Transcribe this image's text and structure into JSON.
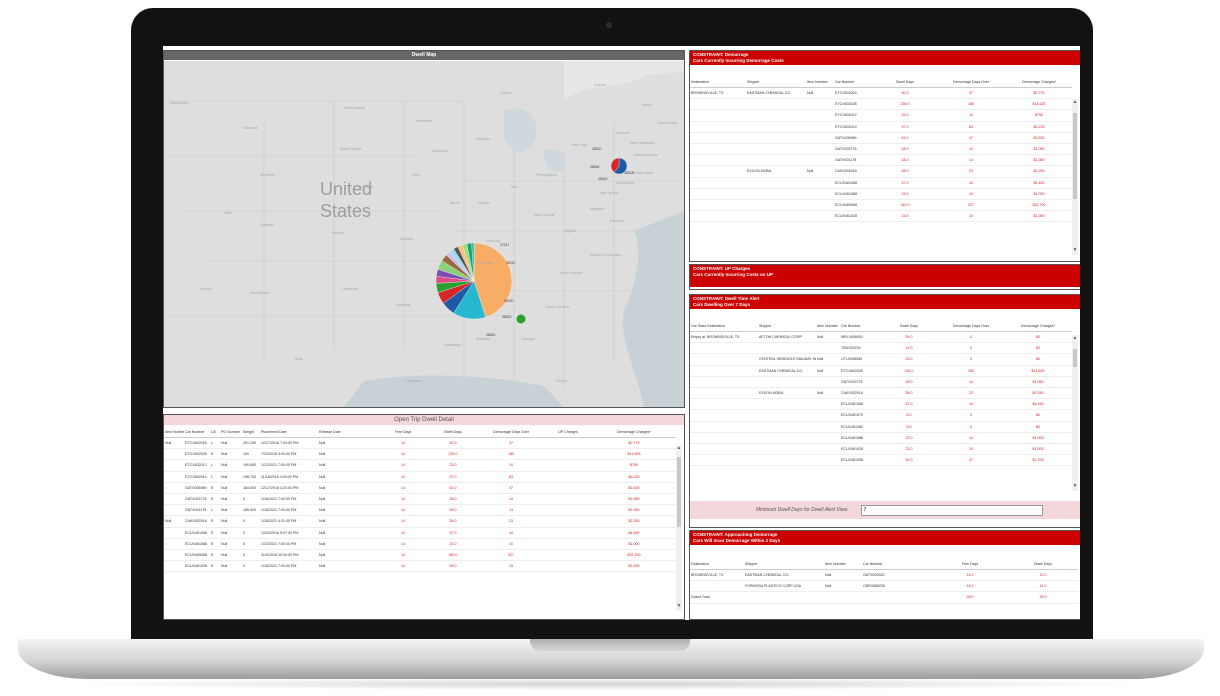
{
  "map": {
    "title": "Dwell Map",
    "big_labels": [
      "United",
      "States"
    ],
    "region_labels": [
      "Montana",
      "North Dakota",
      "Minnesota",
      "South Dakota",
      "Wyoming",
      "Nebraska",
      "Iowa",
      "Illinois",
      "Indiana",
      "Ohio",
      "Michigan",
      "Wisconsin",
      "Pennsylvania",
      "New York",
      "Vermont",
      "Maine",
      "Kansas",
      "Missouri",
      "Kentucky",
      "Virginia",
      "West Virginia",
      "Oklahoma",
      "Arkansas",
      "Tennessee",
      "North Carolina",
      "South Carolina",
      "Georgia",
      "Alabama",
      "Mississippi",
      "Louisiana",
      "Texas",
      "New Jersey",
      "Maryland",
      "Delaware",
      "Rhode Island",
      "Massachusetts",
      "Colorado",
      "New Mexico",
      "Florida",
      "Quebec",
      "Ontario",
      "District of Columbia",
      "Washington",
      "Utah",
      "Arizona",
      "Nova Scotia",
      "Connecticut",
      "New Hampshire"
    ],
    "pie_labels": [
      "38520",
      "38564",
      "38518",
      "37211",
      "35010",
      "35250",
      "38520",
      "38620",
      "39520"
    ],
    "pie_colors": [
      "#f8ad66",
      "#27b8cf",
      "#1f5aa8",
      "#d62728",
      "#2ca02c",
      "#e04c8a",
      "#7b4fb2",
      "#8bd17c",
      "#9a6b3e",
      "#c9c2e8",
      "#9edae5",
      "#555555",
      "#ffbb78",
      "#98df8a",
      "#2a9d5f",
      "#17becf"
    ]
  },
  "open_trip": {
    "title": "Open Trip Dwell Detail",
    "columns": [
      "Item Number",
      "Car Number",
      "L/E",
      "PO Number",
      "Weight",
      "Placement Date",
      "Release Date",
      "Free Days",
      "Dwell Days",
      "Demurrage Days Over",
      "UP Charges",
      "Demurrage Charges*"
    ],
    "rows": [
      [
        "Null",
        "ETCX602016",
        "L",
        "Null",
        "201,150",
        "12/27/2016 7:04:00 PM",
        "Null",
        "14",
        "52.0",
        "37",
        "",
        "$2,775"
      ],
      [
        "",
        "ETCX602028",
        "E",
        "Null",
        "100",
        "7/22/2016 3:00:00 PM",
        "Null",
        "14",
        "230.0",
        "180",
        "",
        "$14,625"
      ],
      [
        "",
        "ETCX602012",
        "L",
        "Null",
        "190,850",
        "1/22/2021 7:00:00 PM",
        "Null",
        "14",
        "23.0",
        "10",
        "",
        "$750"
      ],
      [
        "",
        "ETCX602014",
        "L",
        "Null",
        "198,700",
        "11/18/2016 4:00:00 PM",
        "Null",
        "14",
        "97.0",
        "83",
        "",
        "$6,225"
      ],
      [
        "",
        "GATX006989",
        "E",
        "Null",
        "184,000",
        "12/17/2016 3:20:00 PM",
        "Null",
        "14",
        "61.0",
        "47",
        "",
        "$3,525"
      ],
      [
        "",
        "GATX003778",
        "E",
        "Null",
        "0",
        "1/16/2021 7:00:00 PM",
        "Null",
        "14",
        "28.0",
        "14",
        "",
        "$1,050"
      ],
      [
        "",
        "GATX001178",
        "L",
        "Null",
        "185,900",
        "1/16/2021 7:00:00 PM",
        "Null",
        "14",
        "28.0",
        "14",
        "",
        "$1,050"
      ],
      [
        "Null",
        "CAKX002016",
        "E",
        "Null",
        "0",
        "1/15/2021 4:31:00 PM",
        "Null",
        "14",
        "38.0",
        "23",
        "",
        "$2,250"
      ],
      [
        "",
        "ECUX461068",
        "E",
        "Null",
        "0",
        "12/20/2016 5:47:00 PM",
        "Null",
        "14",
        "57.0",
        "44",
        "",
        "$4,450"
      ],
      [
        "",
        "ECUX461088",
        "E",
        "Null",
        "0",
        "1/22/2021 7:00:00 PM",
        "Null",
        "14",
        "23.0",
        "10",
        "",
        "$1,000"
      ],
      [
        "",
        "ECUX469068",
        "E",
        "Null",
        "0",
        "3/10/2016 10:00:00 PM",
        "Null",
        "14",
        "340.0",
        "327",
        "",
        "$32,700"
      ],
      [
        "",
        "ECUX461028",
        "E",
        "Null",
        "0",
        "1/16/2021 7:00:00 PM",
        "Null",
        "14",
        "28.0",
        "15",
        "",
        "$1,500"
      ]
    ]
  },
  "demurrage": {
    "title": "CONSTRAINT:  Demurrage",
    "subtitle": "Cars Currently Incurring Demurrage Costs",
    "columns": [
      "Destination",
      "Shipper",
      "Item Number",
      "Car Number",
      "Dwell Days",
      "Demurrage Days Over",
      "Demurrage Charges*"
    ],
    "rows": [
      [
        "BROWNSVILLE, TX",
        "EASTMAN CHEMICAL CO.",
        "Null",
        "ETCX602016",
        "50.0",
        "37",
        "$2,775"
      ],
      [
        "",
        "",
        "",
        "ETCX602028",
        "230.0",
        "180",
        "$14,625"
      ],
      [
        "",
        "",
        "",
        "ETCX602012",
        "23.0",
        "10",
        "$750"
      ],
      [
        "",
        "",
        "",
        "ETCX602014",
        "97.0",
        "83",
        "$6,225"
      ],
      [
        "",
        "",
        "",
        "GATX006989",
        "61.0",
        "47",
        "$3,525"
      ],
      [
        "",
        "",
        "",
        "GATX003778",
        "28.0",
        "14",
        "$1,050"
      ],
      [
        "",
        "",
        "",
        "GATX001178",
        "28.0",
        "14",
        "$1,050"
      ],
      [
        "",
        "EXXON MOBIL",
        "Null",
        "CAKX002016",
        "38.0",
        "23",
        "$2,250"
      ],
      [
        "",
        "",
        "",
        "ECUX461068",
        "57.0",
        "44",
        "$4,450"
      ],
      [
        "",
        "",
        "",
        "ECUX461088",
        "23.0",
        "10",
        "$1,000"
      ],
      [
        "",
        "",
        "",
        "ECUX469068",
        "340.0",
        "327",
        "$32,700"
      ],
      [
        "",
        "",
        "",
        "ECUX461028",
        "23.0",
        "10",
        "$1,000"
      ]
    ]
  },
  "up_charges": {
    "title": "CONSTRAINT:  UP Charges",
    "subtitle": "Cars Currently Incurring Costs on UP"
  },
  "dwell_alert": {
    "title": "CONSTRAINT:  Dwell Time Alert",
    "subtitle": "Cars Dwelling Over 7 Days",
    "columns": [
      "Car Status",
      "Destination",
      "Shipper",
      "Item Number",
      "Car Number",
      "Dwell Days",
      "Demurrage Days Over",
      "Demurrage Charges*"
    ],
    "rows": [
      [
        "Empty at Dest",
        "BROWNSVILLE, TX",
        "AFTON CHEMICAL CORP",
        "Null",
        "MRLX006051",
        "55.0",
        "0",
        "$0"
      ],
      [
        "",
        "",
        "",
        "",
        "TBDX00234",
        "19.0",
        "0",
        "$0"
      ],
      [
        "",
        "",
        "CENTRAL SEMINOLE RAILWAY INC",
        "Null",
        "UTLX008089",
        "20.0",
        "0",
        "$0"
      ],
      [
        "",
        "",
        "EASTMAN CHEMICAL CO.",
        "Null",
        "ETCX602028",
        "230.0",
        "183",
        "$14,625"
      ],
      [
        "",
        "",
        "",
        "",
        "GATX003778",
        "28.0",
        "14",
        "$1,050"
      ],
      [
        "",
        "",
        "EXXON MOBIL",
        "Null",
        "CAKX002016",
        "38.0",
        "23",
        "$2,250"
      ],
      [
        "",
        "",
        "",
        "",
        "ECUX461068",
        "57.0",
        "44",
        "$4,450"
      ],
      [
        "",
        "",
        "",
        "",
        "ECUX461070",
        "8.0",
        "0",
        "$0"
      ],
      [
        "",
        "",
        "",
        "",
        "ECUX461082",
        "8.0",
        "0",
        "$0"
      ],
      [
        "",
        "",
        "",
        "",
        "ECUX461088",
        "23.0",
        "10",
        "$1,000"
      ],
      [
        "",
        "",
        "",
        "",
        "ECUX461028",
        "23.0",
        "10",
        "$1,000"
      ],
      [
        "",
        "",
        "",
        "",
        "ECUX461058",
        "50.0",
        "37",
        "$2,700"
      ]
    ],
    "filter_label": "Minimum Dwell Days for Dwell Alert View:",
    "filter_value": "7"
  },
  "approaching": {
    "title": "CONSTRAINT:  Approaching Demurrage",
    "subtitle": "Cars Will Incur Demurrage Within 2 Days",
    "columns": [
      "Destination",
      "Shipper",
      "Item Number",
      "Car Number",
      "Free Days",
      "Dwell Days"
    ],
    "rows": [
      [
        "BROWNSVILLE, TX",
        "EASTMAN CHEMICAL CO.",
        "Null",
        "GATX005330",
        "14.0",
        "12.0"
      ],
      [
        "",
        "FORMOSA PLASTICS CORP USA",
        "Null",
        "CBRX985230",
        "14.0",
        "14.0"
      ],
      [
        "Grand Total",
        "",
        "",
        "",
        "28.0",
        "26.0"
      ]
    ]
  }
}
